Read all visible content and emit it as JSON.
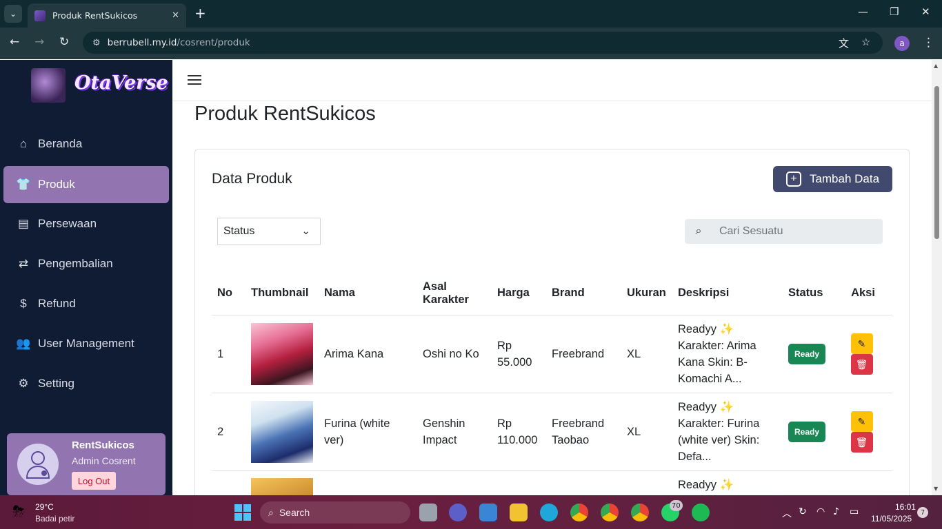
{
  "browser": {
    "tab_title": "Produk RentSukicos",
    "url_host": "berrubell.my.id",
    "url_path": "/cosrent/produk",
    "profile_initial": "a"
  },
  "sidebar": {
    "logo_text": "OtaVerse",
    "logo_img_text": "OtaVerse",
    "items": [
      {
        "label": "Beranda",
        "icon": "home-icon"
      },
      {
        "label": "Produk",
        "icon": "shirt-icon"
      },
      {
        "label": "Persewaan",
        "icon": "cash-register-icon"
      },
      {
        "label": "Pengembalian",
        "icon": "exchange-icon"
      },
      {
        "label": "Refund",
        "icon": "dollar-icon"
      },
      {
        "label": "User Management",
        "icon": "users-icon"
      },
      {
        "label": "Setting",
        "icon": "gear-icon"
      }
    ],
    "active_index": 1,
    "user": {
      "name": "RentSukicos",
      "role": "Admin Cosrent",
      "logout_label": "Log Out"
    }
  },
  "main": {
    "page_title": "Produk RentSukicos",
    "card_title": "Data Produk",
    "add_button": "Tambah Data",
    "status_filter": "Status",
    "search_placeholder": "Cari Sesuatu",
    "columns": [
      "No",
      "Thumbnail",
      "Nama",
      "Asal Karakter",
      "Harga",
      "Brand",
      "Ukuran",
      "Deskripsi",
      "Status",
      "Aksi"
    ],
    "rows": [
      {
        "no": "1",
        "nama": "Arima Kana",
        "asal": "Oshi no Ko",
        "harga": "Rp 55.000",
        "brand": "Freebrand",
        "ukuran": "XL",
        "deskripsi": "Readyy ✨ Karakter: Arima Kana Skin: B-Komachi A...",
        "status": "Ready"
      },
      {
        "no": "2",
        "nama": "Furina (white ver)",
        "asal": "Genshin Impact",
        "harga": "Rp 110.000",
        "brand": "Freebrand Taobao",
        "ukuran": "XL",
        "deskripsi": "Readyy ✨ Karakter: Furina (white ver) Skin: Defa...",
        "status": "Ready"
      },
      {
        "no": "",
        "nama": "",
        "asal": "",
        "harga": "",
        "brand": "",
        "ukuran": "",
        "deskripsi": "Readyy ✨",
        "status": ""
      }
    ]
  },
  "taskbar": {
    "temperature": "29°C",
    "weather": "Badai petir",
    "search_label": "Search",
    "whatsapp_badge": "70",
    "time": "16:01",
    "date": "11/05/2025",
    "notification_count": "7"
  }
}
